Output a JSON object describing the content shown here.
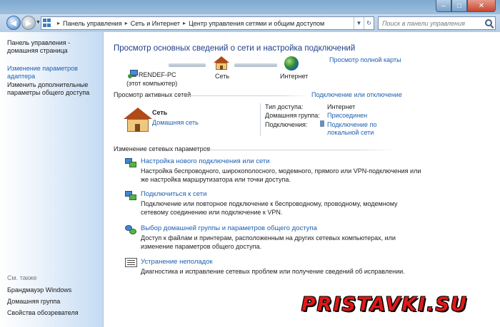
{
  "window": {
    "minimize": "–",
    "maximize": "□",
    "close": "✕"
  },
  "address": {
    "crumbs": [
      "Панель управления",
      "Сеть и Интернет",
      "Центр управления сетями и общим доступом"
    ],
    "search_placeholder": "Поиск в панели управления"
  },
  "sidebar": {
    "home": "Панель управления - домашняя страница",
    "items": [
      "Изменение параметров адаптера",
      "Изменить дополнительные параметры общего доступа"
    ],
    "see_also_title": "См. также",
    "see_also": [
      "Брандмауэр Windows",
      "Домашняя группа",
      "Свойства обозревателя"
    ]
  },
  "main": {
    "title": "Просмотр основных сведений о сети и настройка подключений",
    "full_map": "Просмотр полной карты",
    "map": {
      "computer": "RENDEF-PC",
      "computer_sub": "(этот компьютер)",
      "network": "Сеть",
      "internet": "Интернет"
    },
    "active_title": "Просмотр активных сетей",
    "connect_disconnect": "Подключение или отключение",
    "active_net": {
      "name": "Сеть",
      "type": "Домашняя сеть",
      "access_label": "Тип доступа:",
      "access_value": "Интернет",
      "homegroup_label": "Домашняя группа:",
      "homegroup_value": "Присоединен",
      "connections_label": "Подключения:",
      "connections_value": "Подключение по локальной сети"
    },
    "change_title": "Изменение сетевых параметров",
    "tasks": [
      {
        "title": "Настройка нового подключения или сети",
        "desc": "Настройка беспроводного, широкополосного, модемного, прямого или VPN-подключения или же настройка маршрутизатора или точки доступа."
      },
      {
        "title": "Подключиться к сети",
        "desc": "Подключение или повторное подключение к беспроводному, проводному, модемному сетевому соединению или подключение к VPN."
      },
      {
        "title": "Выбор домашней группы и параметров общего доступа",
        "desc": "Доступ к файлам и принтерам, расположенным на других сетевых компьютерах, или изменение параметров общего доступа."
      },
      {
        "title": "Устранение неполадок",
        "desc": "Диагностика и исправление сетевых проблем или получение сведений об исправлении."
      }
    ]
  },
  "watermark": "PRISTAVKI.SU"
}
